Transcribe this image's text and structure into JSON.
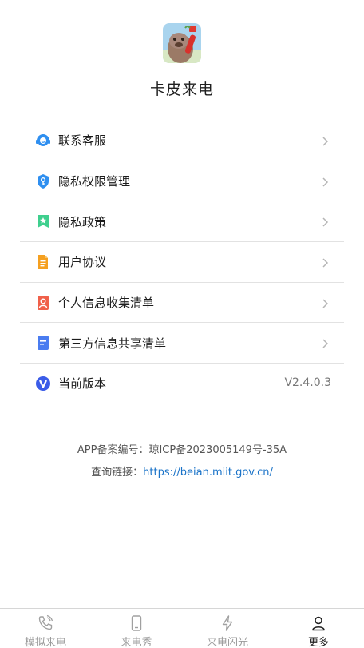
{
  "app": {
    "name": "卡皮来电",
    "logo_icon": "capybara-phone-logo"
  },
  "menu": [
    {
      "label": "联系客服",
      "icon": "customer-service-icon",
      "color": "#2f8ff0",
      "has_arrow": true
    },
    {
      "label": "隐私权限管理",
      "icon": "shield-key-icon",
      "color": "#2f8ff0",
      "has_arrow": true
    },
    {
      "label": "隐私政策",
      "icon": "bookmark-star-icon",
      "color": "#3fcf8e",
      "has_arrow": true
    },
    {
      "label": "用户协议",
      "icon": "document-icon",
      "color": "#f5a020",
      "has_arrow": true
    },
    {
      "label": "个人信息收集清单",
      "icon": "id-card-icon",
      "color": "#f0604a",
      "has_arrow": true
    },
    {
      "label": "第三方信息共享清单",
      "icon": "list-doc-icon",
      "color": "#4a7cf0",
      "has_arrow": true
    },
    {
      "label": "当前版本",
      "icon": "version-v-icon",
      "color": "#3b5ce8",
      "has_arrow": false,
      "value": "V2.4.0.3"
    }
  ],
  "beian": {
    "record": "APP备案编号：琼ICP备2023005149号-35A",
    "query_label": "查询链接：",
    "query_url": "https://beian.miit.gov.cn/"
  },
  "tabs": [
    {
      "label": "模拟来电",
      "icon": "phone-ringing-icon",
      "active": false
    },
    {
      "label": "来电秀",
      "icon": "smartphone-icon",
      "active": false
    },
    {
      "label": "来电闪光",
      "icon": "lightning-icon",
      "active": false
    },
    {
      "label": "更多",
      "icon": "user-icon",
      "active": true
    }
  ],
  "colors": {
    "accent": "#1a73c8",
    "divider": "#e2e2e2",
    "tab_inactive": "#9a9a9a",
    "tab_active": "#222222"
  }
}
